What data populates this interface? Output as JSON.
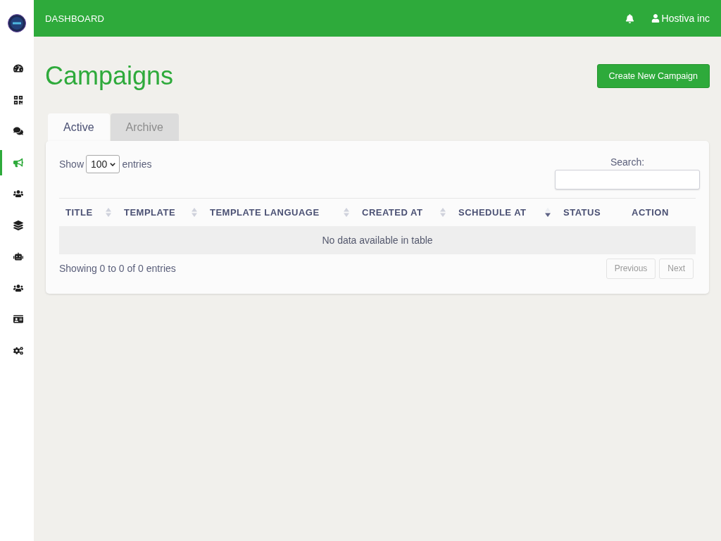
{
  "sidebar": {
    "items": [
      {
        "selected": false
      },
      {
        "selected": false
      },
      {
        "selected": false
      },
      {
        "selected": true
      },
      {
        "selected": false
      },
      {
        "selected": false
      },
      {
        "selected": false
      },
      {
        "selected": false
      },
      {
        "selected": false
      },
      {
        "selected": false
      }
    ]
  },
  "topbar": {
    "title": "DASHBOARD",
    "user": "Hostiva inc"
  },
  "page": {
    "title": "Campaigns",
    "action": "Create New Campaign"
  },
  "tabs": [
    {
      "label": "Active",
      "selected": true
    },
    {
      "label": "Archive",
      "selected": false
    }
  ],
  "table_controls": {
    "show_label": "Show",
    "page_size": "100",
    "entries_label": "entries",
    "search_label": "Search:"
  },
  "table": {
    "columns": [
      {
        "label": "TITLE",
        "sortable": true,
        "sorted_descending": false
      },
      {
        "label": "TEMPLATE",
        "sortable": true,
        "sorted_descending": false
      },
      {
        "label": "TEMPLATE LANGUAGE",
        "sortable": true,
        "sorted_descending": false
      },
      {
        "label": "CREATED AT",
        "sortable": true,
        "sorted_descending": false
      },
      {
        "label": "SCHEDULE AT",
        "sortable": true,
        "sorted_descending": true
      },
      {
        "label": "STATUS",
        "sortable": false
      },
      {
        "label": "ACTION",
        "sortable": false
      }
    ],
    "empty_message": "No data available in table"
  },
  "footer": {
    "info": "Showing 0 to 0 of 0 entries",
    "pagination": [
      {
        "label": "Previous",
        "disabled": true
      },
      {
        "label": "Next",
        "disabled": true
      }
    ]
  }
}
